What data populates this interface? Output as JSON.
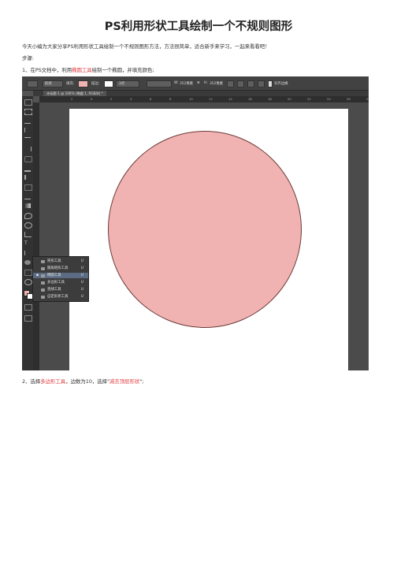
{
  "title": "PS利用形状工具绘制一个不规则图形",
  "intro": "今天小编为大家分享PS利用形状工具绘制一个不规则图形方法，方法很简单，适合新手来学习，一起来看看吧！",
  "steps_label": "步骤:",
  "step1": {
    "prefix": "1、在PS文档中，利用",
    "tool": "椭圆工具",
    "suffix": "绘制一个椭圆，并填充颜色;"
  },
  "step2": {
    "prefix": "2、选择",
    "tool": "多边形工具",
    "middle": "，边数为10，选择\"",
    "option": "减去顶层形状",
    "suffix": "\";"
  },
  "ps": {
    "optbar": {
      "mode": "形状",
      "fill_label": "填充:",
      "stroke_label": "描边:",
      "stroke_size": "3点",
      "w_label": "W:",
      "w_value": "352像素",
      "h_label": "H:",
      "h_value": "352像素",
      "align_edges": "对齐边缘"
    },
    "tab": "未标题-1 @ 100% (椭圆 1, RGB/8) *",
    "ruler_ticks": [
      "2",
      "0",
      "2",
      "4",
      "6",
      "8",
      "10",
      "12",
      "14",
      "16",
      "18",
      "20",
      "22",
      "24",
      "26",
      "28"
    ],
    "fill_color": "#f0b3b1",
    "flyout": [
      {
        "label": "矩形工具",
        "key": "U",
        "selected": false
      },
      {
        "label": "圆角矩形工具",
        "key": "U",
        "selected": false
      },
      {
        "label": "椭圆工具",
        "key": "U",
        "selected": true
      },
      {
        "label": "多边形工具",
        "key": "U",
        "selected": false
      },
      {
        "label": "直线工具",
        "key": "U",
        "selected": false
      },
      {
        "label": "自定形状工具",
        "key": "U",
        "selected": false
      }
    ]
  }
}
